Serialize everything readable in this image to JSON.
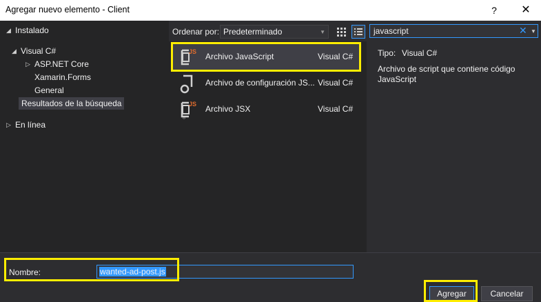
{
  "window": {
    "title": "Agregar nuevo elemento - Client",
    "help_label": "?",
    "close_label": "✕"
  },
  "tree": {
    "installed": "Instalado",
    "visual_csharp": "Visual C#",
    "aspnet_core": "ASP.NET Core",
    "xamarin_forms": "Xamarin.Forms",
    "general": "General",
    "search_results": "Resultados de la búsqueda",
    "online": "En línea"
  },
  "toolbar": {
    "sort_label": "Ordenar por:",
    "sort_value": "Predeterminado"
  },
  "search": {
    "value": "javascript"
  },
  "templates": [
    {
      "name": "Archivo JavaScript",
      "language": "Visual C#",
      "icon": "javascript-file-icon"
    },
    {
      "name": "Archivo de configuración JS...",
      "language": "Visual C#",
      "icon": "js-config-file-icon"
    },
    {
      "name": "Archivo JSX",
      "language": "Visual C#",
      "icon": "jsx-file-icon"
    }
  ],
  "details": {
    "type_label": "Tipo:",
    "type_value": "Visual C#",
    "description": "Archivo de script que contiene código JavaScript"
  },
  "name_field": {
    "label": "Nombre:",
    "value": "wanted-ad-post.js"
  },
  "buttons": {
    "add": "Agregar",
    "cancel": "Cancelar"
  },
  "colors": {
    "accent": "#3399ff",
    "highlight": "#ffee00",
    "js_badge": "#e06c2e"
  }
}
